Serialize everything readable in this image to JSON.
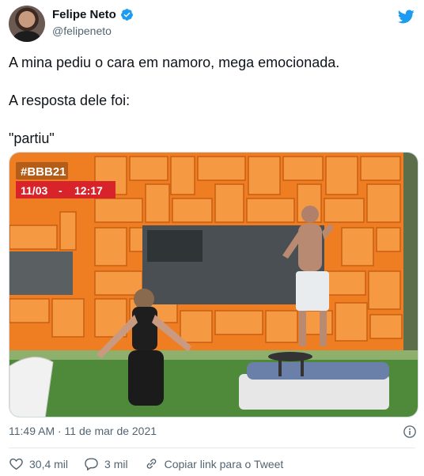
{
  "author": {
    "name": "Felipe Neto",
    "handle": "@felipeneto"
  },
  "tweet": {
    "lines": [
      "A mina pediu o cara em namoro, mega emocionada.",
      "A resposta dele foi:",
      "\"partiu\""
    ],
    "timestamp": "11:49 AM · 11 de mar de 2021"
  },
  "media": {
    "overlay_tag": "#BBB21",
    "overlay_date": "11/03",
    "overlay_time": "12:17"
  },
  "actions": {
    "likes": "30,4 mil",
    "replies": "3 mil",
    "copy_link": "Copiar link para o Tweet"
  },
  "colors": {
    "twitter_blue": "#1d9bf0",
    "secondary_text": "#536471",
    "overlay_red": "#d8232a"
  }
}
